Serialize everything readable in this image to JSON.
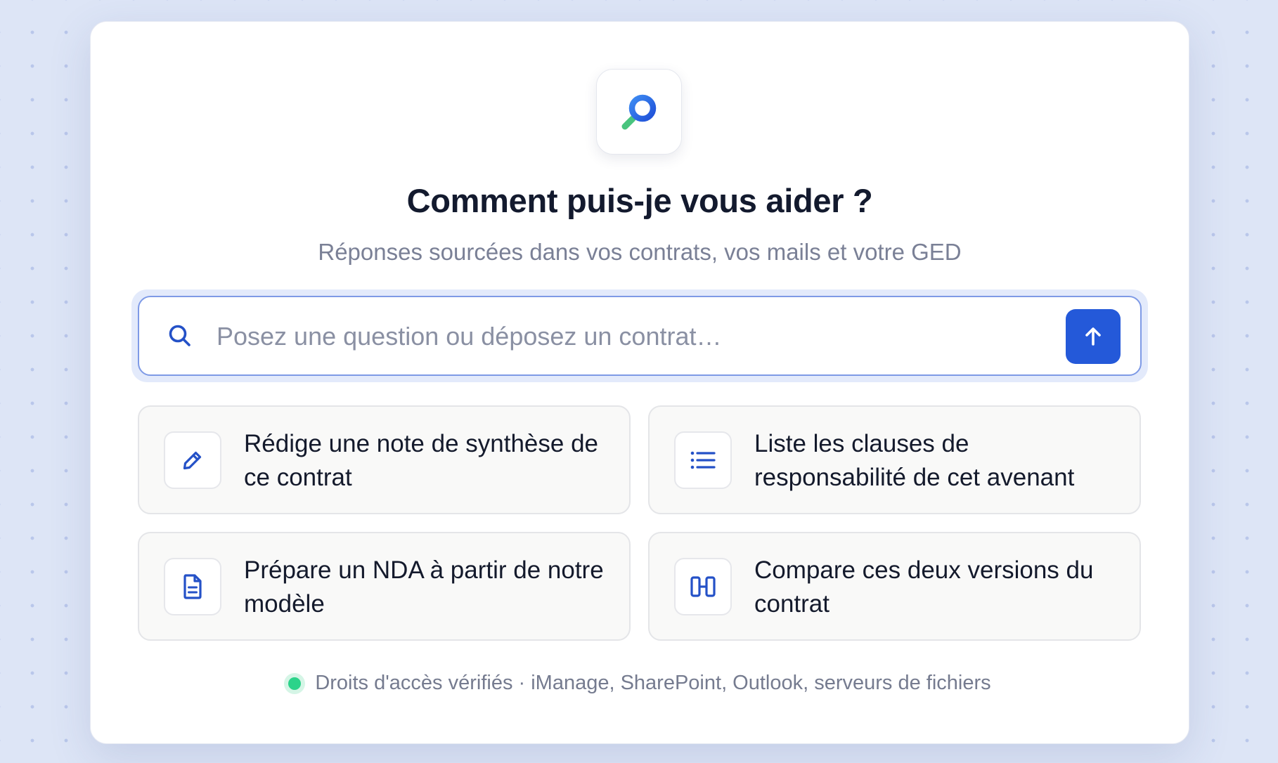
{
  "hero": {
    "logo_icon": "search-logo-icon",
    "title": "Comment puis-je vous aider ?",
    "subtitle": "Réponses sourcées dans vos contrats, vos mails et votre GED"
  },
  "search": {
    "placeholder": "Posez une question ou déposez un contrat…",
    "value": "",
    "icon": "search-icon",
    "send_icon": "arrow-up-icon"
  },
  "suggestions": [
    {
      "icon": "pencil-icon",
      "label": "Rédige une note de synthèse de ce contrat"
    },
    {
      "icon": "list-icon",
      "label": "Liste les clauses de responsabilité de cet avenant"
    },
    {
      "icon": "document-icon",
      "label": "Prépare un NDA à partir de notre modèle"
    },
    {
      "icon": "compare-columns-icon",
      "label": "Compare ces deux versions du contrat"
    }
  ],
  "footer": {
    "status_color": "#2bd38a",
    "text": "Droits d'accès vérifiés · iManage, SharePoint, Outlook, serveurs de fichiers"
  },
  "colors": {
    "accent": "#2459d9",
    "icon_blue": "#2451c7",
    "status_green": "#2bd38a"
  }
}
